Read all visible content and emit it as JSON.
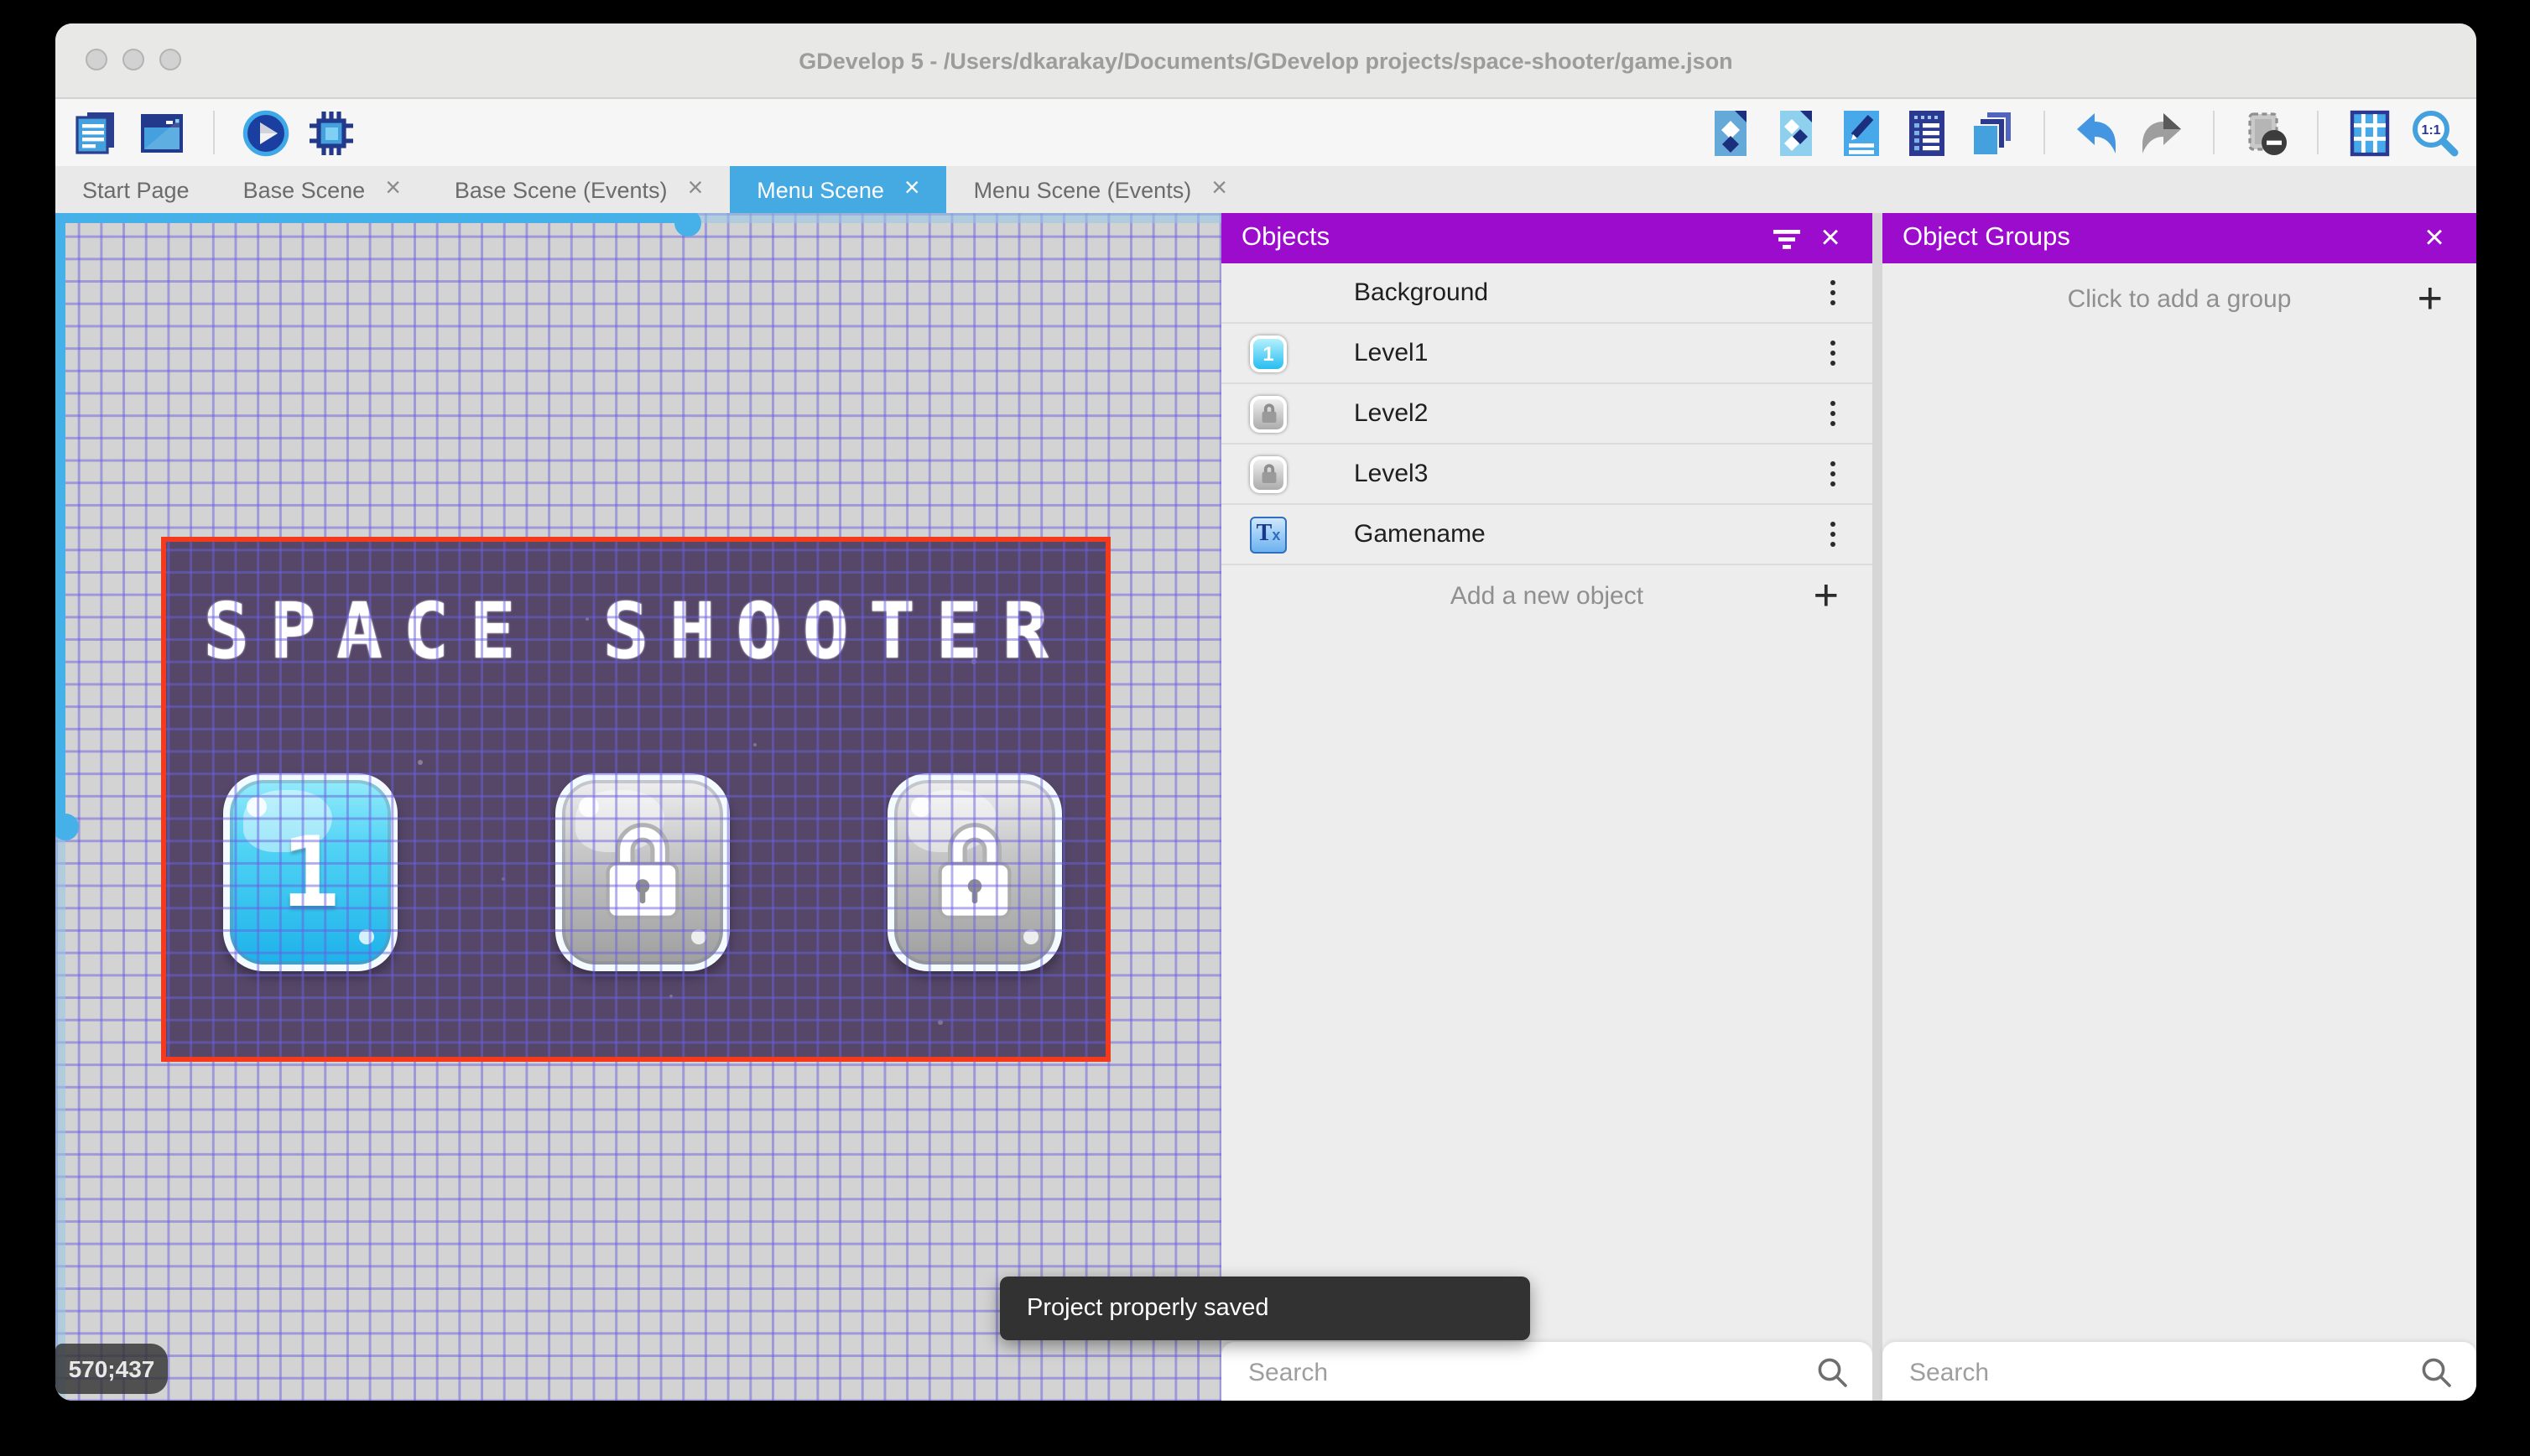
{
  "window": {
    "title": "GDevelop 5 - /Users/dkarakay/Documents/GDevelop projects/space-shooter/game.json"
  },
  "tabs": [
    {
      "label": "Start Page",
      "closable": false,
      "active": false
    },
    {
      "label": "Base Scene",
      "closable": true,
      "active": false
    },
    {
      "label": "Base Scene (Events)",
      "closable": true,
      "active": false
    },
    {
      "label": "Menu Scene",
      "closable": true,
      "active": true
    },
    {
      "label": "Menu Scene (Events)",
      "closable": true,
      "active": false
    }
  ],
  "canvas": {
    "coordinates": "570;437",
    "scene": {
      "title": "SPACE SHOOTER",
      "level_buttons": [
        {
          "label": "1",
          "state": "unlocked"
        },
        {
          "label": "",
          "state": "locked"
        },
        {
          "label": "",
          "state": "locked"
        }
      ]
    }
  },
  "objects_panel": {
    "title": "Objects",
    "rows": [
      {
        "name": "Background",
        "thumb": "purple-swatch"
      },
      {
        "name": "Level1",
        "thumb": "blue-button-1"
      },
      {
        "name": "Level2",
        "thumb": "gray-lock-button"
      },
      {
        "name": "Level3",
        "thumb": "gray-lock-button"
      },
      {
        "name": "Gamename",
        "thumb": "text-object"
      }
    ],
    "add_label": "Add a new object",
    "search_placeholder": "Search"
  },
  "groups_panel": {
    "title": "Object Groups",
    "add_label": "Click to add a group",
    "search_placeholder": "Search"
  },
  "toast": {
    "message": "Project properly saved"
  },
  "colors": {
    "accent_purple": "#9c0ccd",
    "active_tab_blue": "#45a9e2",
    "selection_red": "#f43a1d",
    "scene_purple": "#564769",
    "grid_line_blue": "#695fde",
    "scrollbar_blue": "#45b1e8",
    "toast_gray": "#323232"
  }
}
